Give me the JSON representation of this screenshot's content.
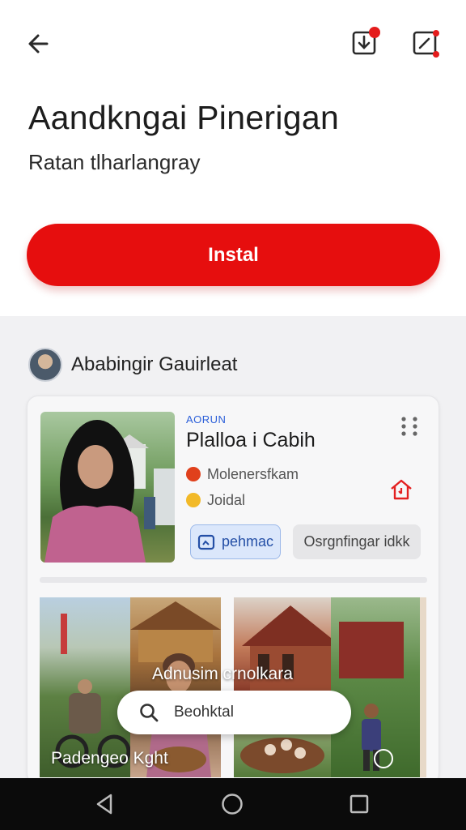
{
  "app": {
    "title": "Aandkngai Pinerigan",
    "subtitle": "Ratan tlharlangray",
    "install_label": "Instal"
  },
  "author": {
    "name": "Ababingir Gauirleat"
  },
  "post": {
    "tag": "AORUN",
    "title": "Plalloa i Cabih",
    "meta": [
      {
        "icon": "flame-icon",
        "text": "Molenersfkam",
        "color": "#e0401c"
      },
      {
        "icon": "smile-icon",
        "text": "Joidal",
        "color": "#f2b928"
      }
    ],
    "chip_primary": "pehmac",
    "chip_secondary": "Osrgnfingar idkk"
  },
  "gallery": {
    "overlay_title": "Adnusim crnolkara",
    "overlay_caption": "Padengeo Kght",
    "search_text": "Beohktal"
  },
  "colors": {
    "accent": "#e60e0e",
    "link": "#2b5fd9",
    "notification_dot": "#e41c1c"
  },
  "icons": {
    "back": "back-arrow-icon",
    "download": "download-icon",
    "edit": "edit-icon",
    "more": "more-dots-icon",
    "home": "home-icon",
    "search": "search-icon",
    "nav_back": "nav-back-icon",
    "nav_home": "nav-home-icon",
    "nav_recents": "nav-recents-icon"
  }
}
